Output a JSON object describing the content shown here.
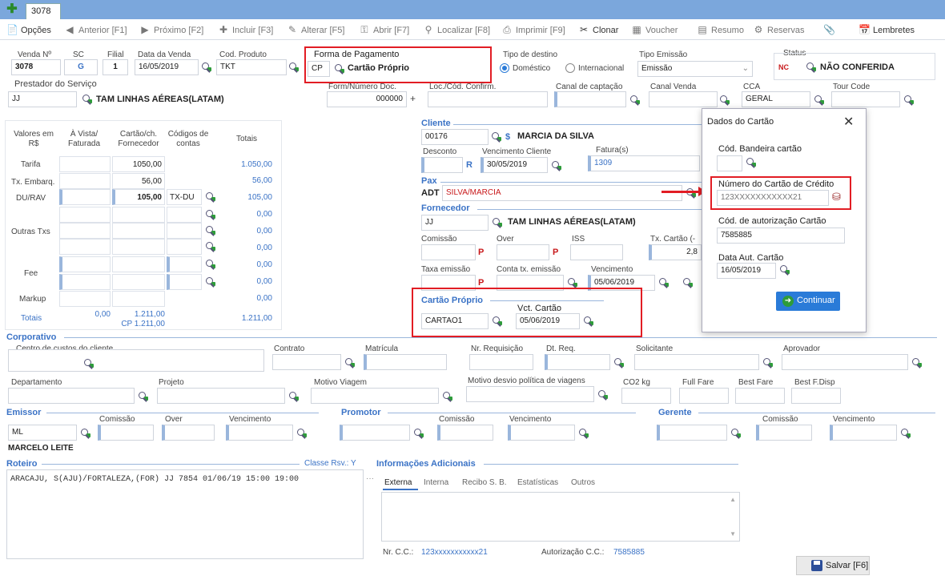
{
  "tabbar": {
    "tab": "3078"
  },
  "toolbar": [
    "Opções",
    "Anterior [F1]",
    "Próximo [F2]",
    "Incluir [F3]",
    "Alterar [F5]",
    "Abrir [F7]",
    "Localizar [F8]",
    "Imprimir [F9]",
    "Clonar",
    "Voucher",
    "Resumo",
    "Reservas",
    "Lembretes"
  ],
  "venda": {
    "l_venda": "Venda Nº",
    "venda": "3078",
    "l_sc": "SC",
    "sc": "G",
    "l_filial": "Filial",
    "filial": "1",
    "l_data": "Data da Venda",
    "data": "16/05/2019",
    "l_cod": "Cod. Produto",
    "cod": "TKT"
  },
  "fp": {
    "label": "Forma de Pagamento",
    "code": "CP",
    "value": "Cartão Próprio"
  },
  "destino": {
    "label": "Tipo de destino",
    "opt1": "Doméstico",
    "opt2": "Internacional"
  },
  "emissao": {
    "label": "Tipo Emissão",
    "value": "Emissão"
  },
  "status": {
    "label": "Status",
    "badge": "NC",
    "value": "NÃO CONFERIDA"
  },
  "prestador": {
    "label": "Prestador do Serviço",
    "code": "JJ",
    "name": "TAM LINHAS AÉREAS(LATAM)"
  },
  "row2": {
    "l_form": "Form/Número Doc.",
    "form": "000000",
    "l_loc": "Loc./Cód. Confirm.",
    "l_canal": "Canal de captação",
    "l_canalv": "Canal Venda",
    "l_cca": "CCA",
    "cca": "GERAL",
    "l_tour": "Tour Code"
  },
  "valores": {
    "h1": "Valores em R$",
    "h2": "À Vista/ Faturada",
    "h3": "Cartão/ch. Fornecedor",
    "h4": "Códigos de contas",
    "h5": "Totais",
    "rows": [
      "Tarifa",
      "Tx. Embarq.",
      "DU/RAV",
      "Outras Txs",
      "Fee",
      "Markup"
    ],
    "c_tarifa": "1050,00",
    "c_emb": "56,00",
    "c_du": "105,00",
    "code_du": "TX-DU",
    "t1": "1.050,00",
    "t2": "56,00",
    "t3": "105,00",
    "t4": "0,00",
    "t5": "0,00",
    "t6": "0,00",
    "t7": "0,00",
    "t8": "0,00",
    "t9": "0,00",
    "t10": "0,00",
    "totais": "Totais",
    "tot_vista": "0,00",
    "tot_cartao": "1.211,00",
    "tot_cp": "CP 1.211,00",
    "tot_total": "1.211,00"
  },
  "cliente": {
    "title": "Cliente",
    "code": "00176",
    "name": "MARCIA DA SILVA",
    "l_desc": "Desconto",
    "l_venc": "Vencimento Cliente",
    "venc": "30/05/2019",
    "l_fat": "Fatura(s)",
    "fat": "1309",
    "r": "R"
  },
  "pax": {
    "title": "Pax",
    "adt": "ADT",
    "name": "SILVA/MARCIA"
  },
  "fornecedor": {
    "title": "Fornecedor",
    "code": "JJ",
    "name": "TAM LINHAS AÉREAS(LATAM)",
    "l_com": "Comissão",
    "l_over": "Over",
    "l_iss": "ISS",
    "l_txc": "Tx. Cartão (-",
    "txc": "2,8",
    "l_taxa": "Taxa emissão",
    "l_conta": "Conta tx. emissão",
    "l_venc": "Vencimento",
    "venc": "05/06/2019",
    "p": "P"
  },
  "cartao": {
    "title": "Cartão Próprio",
    "code": "CARTAO1",
    "l_vct": "Vct. Cartão",
    "vct": "05/06/2019"
  },
  "dialog": {
    "title": "Dados do Cartão",
    "l_band": "Cód. Bandeira cartão",
    "l_num": "Número do Cartão de Crédito",
    "num": "123XXXXXXXXXXX21",
    "l_aut": "Cód. de autorização Cartão",
    "aut": "7585885",
    "l_data": "Data Aut. Cartão",
    "data": "16/05/2019",
    "btn": "Continuar"
  },
  "corp": {
    "title": "Corporativo",
    "l1": "Centro de custos do cliente",
    "l2": "Contrato",
    "l3": "Matrícula",
    "l4": "Nr. Requisição",
    "l5": "Dt. Req.",
    "l6": "Solicitante",
    "l7": "Aprovador",
    "l8": "Departamento",
    "l9": "Projeto",
    "l10": "Motivo Viagem",
    "l11": "Motivo desvio política de viagens",
    "l12": "CO2 kg",
    "l13": "Full Fare",
    "l14": "Best Fare",
    "l15": "Best F.Disp"
  },
  "emissor": {
    "title": "Emissor",
    "code": "ML",
    "name": "MARCELO LEITE",
    "l_com": "Comissão",
    "l_over": "Over",
    "l_venc": "Vencimento",
    "promotor": "Promotor",
    "gerente": "Gerente"
  },
  "roteiro": {
    "title": "Roteiro",
    "classe": "Classe Rsv.: Y",
    "text": "ARACAJU, S(AJU)/FORTALEZA,(FOR) JJ 7854 01/06/19 15:00 19:00"
  },
  "info": {
    "title": "Informações Adicionais",
    "tabs": [
      "Externa",
      "Interna",
      "Recibo S. B.",
      "Estatísticas",
      "Outros"
    ],
    "l_nrcc": "Nr. C.C.:",
    "nrcc": "123xxxxxxxxxxx21",
    "l_aut": "Autorização C.C.:",
    "aut": "7585885"
  },
  "salvar": "Salvar [F6]",
  "colors": {
    "accent": "#3b73c6",
    "tabbar": "#7ba7dc",
    "highlight": "#e21d24",
    "button": "#2a7bd8"
  }
}
